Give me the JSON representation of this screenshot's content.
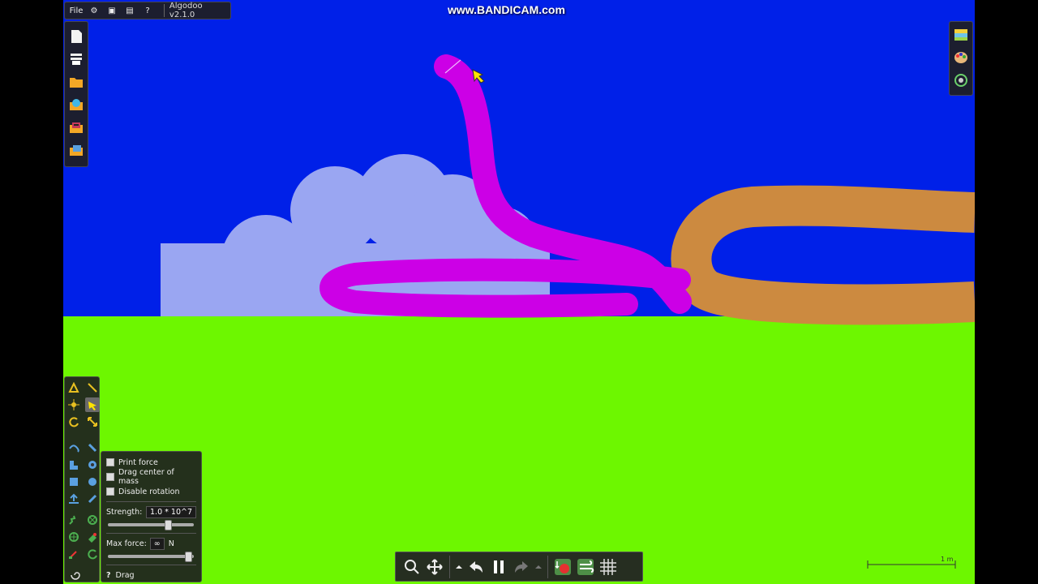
{
  "app": {
    "title": "Algodoo v2.1.0",
    "file_menu": "File",
    "watermark": "www.BANDICAM.com"
  },
  "colors": {
    "sky": "#0020E8",
    "ground": "#6DF700",
    "cloud": "#9AA6F2",
    "snake": "#CC00E6",
    "rope": "#CC8A40"
  },
  "left_toolbar_top": [
    {
      "name": "new-scene-icon"
    },
    {
      "name": "scene-settings-icon"
    },
    {
      "name": "open-folder-icon"
    },
    {
      "name": "browse-scenes-icon"
    },
    {
      "name": "phunlets-icon"
    },
    {
      "name": "save-folder-icon"
    }
  ],
  "right_toolbar": [
    {
      "name": "background-icon"
    },
    {
      "name": "palette-icon"
    },
    {
      "name": "skin-icon"
    }
  ],
  "drag_options": {
    "print_force": "Print force",
    "drag_center": "Drag center of mass",
    "disable_rotation": "Disable rotation",
    "strength_label": "Strength:",
    "strength_value": "1.0 * 10^7",
    "maxforce_label": "Max force:",
    "maxforce_value": "∞",
    "maxforce_unit": "N",
    "tool_name": "Drag",
    "help": "?",
    "strength_slider": 0.72,
    "maxforce_slider": 0.98
  },
  "scale": {
    "label": "1 m"
  },
  "bottom_toolbar": [
    {
      "name": "zoom-icon"
    },
    {
      "name": "move-icon"
    },
    {
      "name": "undo-dropdown-icon"
    },
    {
      "name": "undo-icon"
    },
    {
      "name": "pause-icon"
    },
    {
      "name": "redo-icon"
    },
    {
      "name": "redo-dropdown-icon"
    },
    {
      "name": "gravity-icon"
    },
    {
      "name": "air-friction-icon"
    },
    {
      "name": "grid-icon"
    }
  ]
}
